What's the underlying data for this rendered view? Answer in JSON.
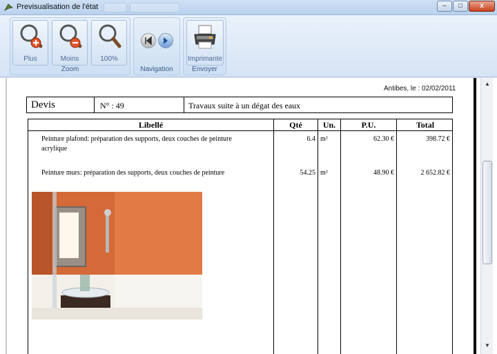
{
  "window": {
    "title": "Previsualisation de l'état",
    "min_glyph": "–",
    "max_glyph": "□",
    "close_glyph": "x"
  },
  "ribbon": {
    "groups": [
      {
        "label": "Zoom",
        "buttons": [
          {
            "label": "Plus",
            "icon": "zoom-in-icon"
          },
          {
            "label": "Moins",
            "icon": "zoom-out-icon"
          },
          {
            "label": "100%",
            "icon": "zoom-100-icon"
          }
        ]
      },
      {
        "label": "Navigation",
        "buttons": [
          {
            "label": "",
            "icon": "page-first-icon"
          },
          {
            "label": "",
            "icon": "page-next-icon"
          }
        ]
      },
      {
        "label": "Envoyer",
        "buttons": [
          {
            "label": "Imprimante",
            "icon": "printer-icon"
          }
        ]
      }
    ]
  },
  "document": {
    "location_date": "Antibes, le :  02/02/2011",
    "header": {
      "doc_type": "Devis",
      "number": "N° : 49",
      "subject": "Travaux suite à un dégat des eaux"
    },
    "columns": [
      "Libellé",
      "Qté",
      "Un.",
      "P.U.",
      "Total"
    ],
    "rows": [
      {
        "description_line1": "Peinture plafond: préparation des supports, deux couches de peinture",
        "description_line2": "acrylique",
        "qty": "6.4",
        "unit": "m²",
        "unit_price": "62.30 €",
        "total": "398.72 €"
      },
      {
        "description_line1": "Peinture murs: préparation des supports, deux couches de peinture",
        "description_line2": "",
        "qty": "54.25",
        "unit": "m²",
        "unit_price": "48.90 €",
        "total": "2 652.82 €"
      }
    ]
  },
  "colors": {
    "ribbon_text": "#4b6a94",
    "group_label": "#3a5a86",
    "wall_orange": "#d9703f"
  }
}
